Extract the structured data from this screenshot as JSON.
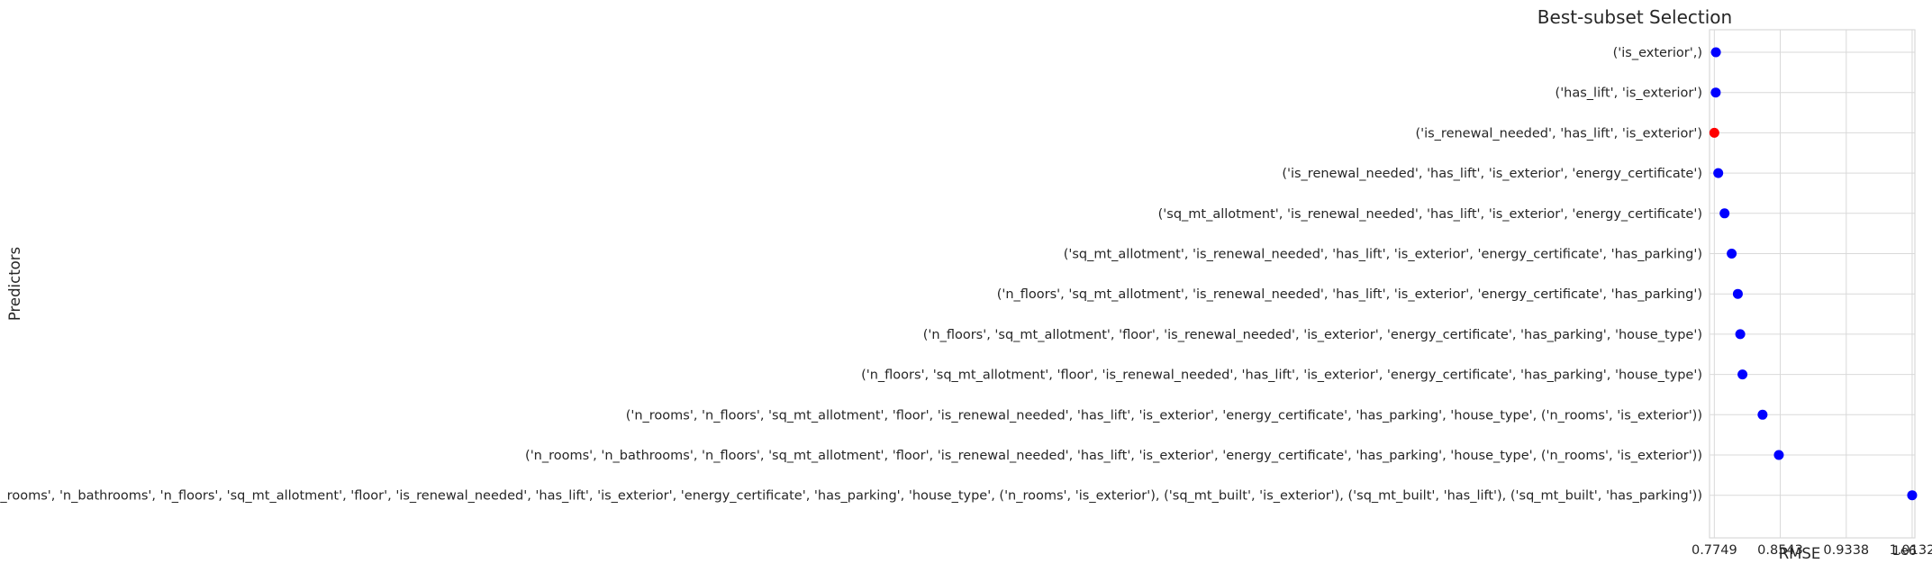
{
  "chart_data": {
    "type": "scatter",
    "title": "Best-subset Selection",
    "xlabel": "RMSE",
    "ylabel": "Predictors",
    "x_offset_label": "1e6",
    "x_tick_values": [
      0.7749,
      0.8543,
      0.9338,
      1.0132
    ],
    "x_tick_labels": [
      "0.7749",
      "0.8543",
      "0.9338",
      "1.0132"
    ],
    "xlim": [
      0.7691,
      1.0165
    ],
    "grid": true,
    "default_color": "#0000ff",
    "highlight_color": "#ff0000",
    "categories": [
      "('is_exterior',)",
      "('has_lift', 'is_exterior')",
      "('is_renewal_needed', 'has_lift', 'is_exterior')",
      "('is_renewal_needed', 'has_lift', 'is_exterior', 'energy_certificate')",
      "('sq_mt_allotment', 'is_renewal_needed', 'has_lift', 'is_exterior', 'energy_certificate')",
      "('sq_mt_allotment', 'is_renewal_needed', 'has_lift', 'is_exterior', 'energy_certificate', 'has_parking')",
      "('n_floors', 'sq_mt_allotment', 'is_renewal_needed', 'has_lift', 'is_exterior', 'energy_certificate', 'has_parking')",
      "('n_floors', 'sq_mt_allotment', 'floor', 'is_renewal_needed', 'is_exterior', 'energy_certificate', 'has_parking', 'house_type')",
      "('n_floors', 'sq_mt_allotment', 'floor', 'is_renewal_needed', 'has_lift', 'is_exterior', 'energy_certificate', 'has_parking', 'house_type')",
      "('n_rooms', 'n_floors', 'sq_mt_allotment', 'floor', 'is_renewal_needed', 'has_lift', 'is_exterior', 'energy_certificate', 'has_parking', 'house_type', ('n_rooms', 'is_exterior'))",
      "('n_rooms', 'n_bathrooms', 'n_floors', 'sq_mt_allotment', 'floor', 'is_renewal_needed', 'has_lift', 'is_exterior', 'energy_certificate', 'has_parking', 'house_type', ('n_rooms', 'is_exterior'))",
      "('sq_mt_built', 'n_rooms', 'n_bathrooms', 'n_floors', 'sq_mt_allotment', 'floor', 'is_renewal_needed', 'has_lift', 'is_exterior', 'energy_certificate', 'has_parking', 'house_type', ('n_rooms', 'is_exterior'), ('sq_mt_built', 'is_exterior'), ('sq_mt_built', 'has_lift'), ('sq_mt_built', 'has_parking'))"
    ],
    "values": [
      0.7768,
      0.7766,
      0.7749,
      0.7796,
      0.7872,
      0.7958,
      0.8032,
      0.8061,
      0.8088,
      0.833,
      0.8526,
      1.0132
    ],
    "highlight_index": 2
  }
}
